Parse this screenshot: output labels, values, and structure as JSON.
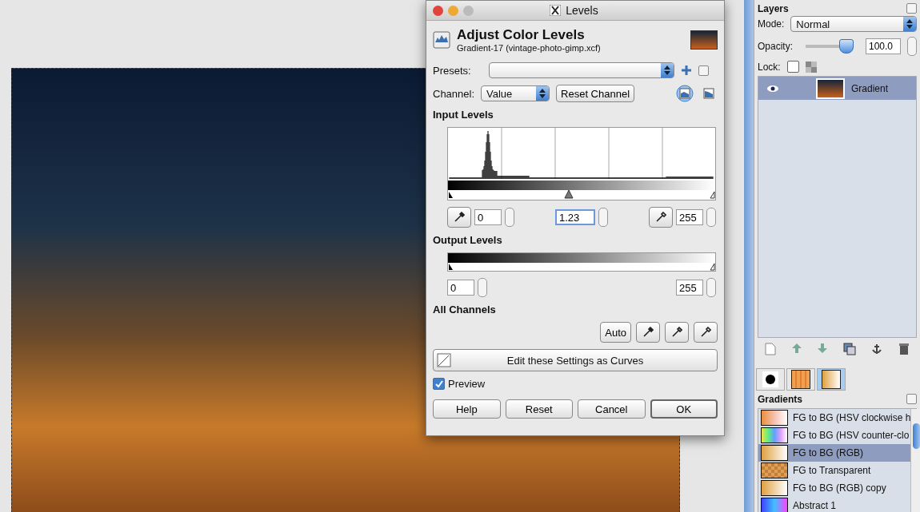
{
  "dialog": {
    "title": "Levels",
    "heading": "Adjust Color Levels",
    "subtitle": "Gradient-17 (vintage-photo-gimp.xcf)",
    "presets_label": "Presets:",
    "channel_label": "Channel:",
    "channel_value": "Value",
    "reset_channel": "Reset Channel",
    "histogram_modes": [
      {
        "kind": "linear",
        "selected": true
      },
      {
        "kind": "log",
        "selected": false
      }
    ],
    "input_levels": {
      "title": "Input Levels",
      "low": "0",
      "gamma": "1.23",
      "high": "255"
    },
    "output_levels": {
      "title": "Output Levels",
      "low": "0",
      "high": "255"
    },
    "all_channels": {
      "title": "All Channels",
      "auto": "Auto"
    },
    "curves_button": "Edit these Settings as Curves",
    "preview": {
      "label": "Preview",
      "checked": true
    },
    "buttons": [
      {
        "label": "Help",
        "default": false
      },
      {
        "label": "Reset",
        "default": false
      },
      {
        "label": "Cancel",
        "default": false
      },
      {
        "label": "OK",
        "default": true
      }
    ]
  },
  "layers": {
    "title": "Layers",
    "mode_label": "Mode:",
    "mode": "Normal",
    "opacity_label": "Opacity:",
    "opacity": {
      "level": 0.85
    },
    "opacity_value": "100.0",
    "lock_label": "Lock:",
    "lock_checked": false,
    "items": [
      {
        "name": "Gradient",
        "visible": true,
        "selected": true
      }
    ]
  },
  "dock_tabs": [
    {
      "kind": "brush",
      "selected": false
    },
    {
      "kind": "pattern",
      "selected": false
    },
    {
      "kind": "gradient",
      "selected": true
    }
  ],
  "gradients": {
    "title": "Gradients",
    "items": [
      {
        "name": "FG to BG (HSV clockwise h",
        "kind": "hsv-cw",
        "selected": false
      },
      {
        "name": "FG to BG (HSV counter-clo",
        "kind": "hsv-ccw",
        "selected": false
      },
      {
        "name": "FG to BG (RGB)",
        "kind": "rgb",
        "selected": true
      },
      {
        "name": "FG to Transparent",
        "kind": "transparent",
        "selected": false
      },
      {
        "name": "FG to BG (RGB) copy",
        "kind": "rgb",
        "selected": false
      },
      {
        "name": "Abstract 1",
        "kind": "abstract",
        "selected": false
      }
    ]
  }
}
